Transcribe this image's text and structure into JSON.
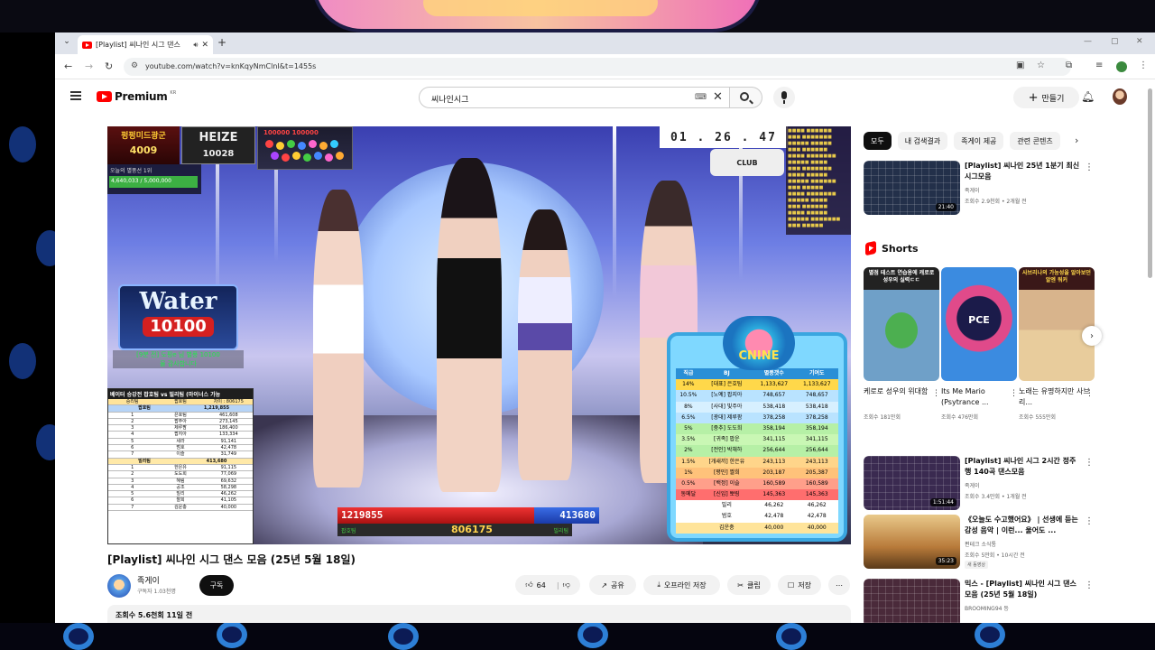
{
  "browser": {
    "tab_title": "[Playlist] 씨나인 시그 댄스",
    "url": "youtube.com/watch?v=knKqyNmClnI&t=1455s"
  },
  "header": {
    "logo_text": "Premium",
    "logo_region": "KR",
    "search_value": "씨나인시그",
    "create_label": "만들기"
  },
  "video_overlay": {
    "badge1_top": "펑펑미드광군",
    "badge1_num": "4009",
    "badge2_top": "HEIZE",
    "badge2_num": "10028",
    "balls_label": "100000 100000",
    "status_line1": "오늘의 별풍선 1위",
    "status_line2": "4,640,033 / 5,000,000",
    "timer": "01 . 26 . 47",
    "tr_logo": "CLUB",
    "water_title": "Water",
    "water_num": "10100",
    "water_sub1": "[9분 전] 도핑e 님 별풍 10100",
    "water_sub2": "물 감사합니다",
    "score_left": "1219855",
    "score_right": "413680",
    "score_mid": "806175",
    "score_left_team": "팝호팀",
    "score_right_team": "빌리팀",
    "board_logo": "CNINE",
    "board_headers": [
      "직급",
      "BJ",
      "별풍갯수",
      "기여도"
    ],
    "board_rows": [
      [
        "14%",
        "[대표] 은호팀",
        "1,133,627",
        "1,133,627"
      ],
      [
        "10.5%",
        "[노예] 팝지아",
        "748,657",
        "748,657"
      ],
      [
        "8%",
        "[사대] 빛주아",
        "538,418",
        "538,418"
      ],
      [
        "6.5%",
        "[광대] 제루팜",
        "378,258",
        "378,258"
      ],
      [
        "5%",
        "[중추] 도도희",
        "358,194",
        "358,194"
      ],
      [
        "3.5%",
        "[귀족] 팝운",
        "341,115",
        "341,115"
      ],
      [
        "2%",
        "[전인] 박채하",
        "256,644",
        "256,644"
      ],
      [
        "1.5%",
        "[개새끼] 한은유",
        "243,113",
        "243,113"
      ],
      [
        "1%",
        "[평민] 짤희",
        "203,187",
        "205,387"
      ],
      [
        "0.5%",
        "[백정] 이슬",
        "160,589",
        "160,589"
      ],
      [
        "동메달",
        "[신입] 뽀링",
        "145,363",
        "145,363"
      ],
      [
        "",
        "빌리",
        "46,262",
        "46,262"
      ],
      [
        "",
        "범호",
        "42,478",
        "42,478"
      ],
      [
        "",
        "김운충",
        "40,000",
        "40,000"
      ]
    ],
    "lb_header": "베이터 승강전 팝호팀 vs 빌리팀 (마이너스 가능",
    "lb_gap_label": "승리팀",
    "lb_gap_team": "팝호팀",
    "lb_gap_value": "차이 : 806175",
    "lb_team1": "팝호팀",
    "lb_team1_total": "1,219,855",
    "lb_team1_rows": [
      [
        "1",
        "은호팀",
        "461,608"
      ],
      [
        "2",
        "팝주아",
        "273,145"
      ],
      [
        "3",
        "제루팜",
        "186,400"
      ],
      [
        "4",
        "팝지아",
        "133,334"
      ],
      [
        "5",
        "세라",
        "91,141"
      ],
      [
        "6",
        "범호",
        "42,478"
      ],
      [
        "7",
        "이슬",
        "31,749"
      ]
    ],
    "lb_team2": "빌리팀",
    "lb_team2_total": "413,680",
    "lb_team2_rows": [
      [
        "1",
        "한은유",
        "91,115"
      ],
      [
        "2",
        "도도희",
        "77,069"
      ],
      [
        "3",
        "혜림",
        "69,632"
      ],
      [
        "4",
        "공조",
        "58,298"
      ],
      [
        "5",
        "빌리",
        "46,262"
      ],
      [
        "6",
        "짤희",
        "41,105"
      ],
      [
        "7",
        "김운충",
        "40,000"
      ]
    ]
  },
  "video": {
    "title": "[Playlist] 씨나인 시그 댄스 모음 (25년 5월 18일)",
    "channel_name": "족게이",
    "channel_subs": "구독자 1.03천명",
    "subscribe_label": "구독",
    "like_count": "64",
    "share_label": "공유",
    "offline_label": "오프라인 저장",
    "clip_label": "클립",
    "save_label": "저장",
    "views_line": "조회수 5.6천회  11일 전"
  },
  "sidebar": {
    "chips": [
      "모두",
      "내 검색결과",
      "족게이 제공",
      "관련 콘텐츠"
    ],
    "shorts_title": "Shorts",
    "rec1": {
      "title": "[Playlist] 씨나인 25년 1분기 최신 시그모음",
      "channel": "족게이",
      "meta": "조회수 2.9천회 • 2개월 전",
      "duration": "21:40"
    },
    "shorts": [
      {
        "overlay": "별점 테스트 연습용에 캐로로 성우의 실력ㄷㄷ",
        "title": "케로로 성우의 위대함",
        "views": "조회수 181만회"
      },
      {
        "overlay": "PCE",
        "title": "Its Me Mario (Psytrance ...",
        "views": "조회수 476만회"
      },
      {
        "overlay": "사브리나의 가능성을 알아보던 알엔 워커",
        "title": "노래는 유명하지만 사브리...",
        "views": "조회수 555만회"
      }
    ],
    "rec2": {
      "title": "[Playlist] 씨나인 시그 2시간 정주행 140곡 댄스모음",
      "channel": "족게이",
      "meta": "조회수 3.4만회 • 1개월 전",
      "duration": "1:51:44"
    },
    "rec3": {
      "title": "《오늘도 수고했어요》 | 선생에 듣는 감성 음악 | 이런... 울어도 ...",
      "channel": "편테크 소식통",
      "meta": "조회수 5만회 • 10시간 전",
      "new": "새 동영상",
      "duration": "35:23"
    },
    "rec4": {
      "title": "믹스 - [Playlist] 씨나인 시그 댄스 모음 (25년 5월 18일)",
      "channel": "BROOMING94 등"
    }
  }
}
